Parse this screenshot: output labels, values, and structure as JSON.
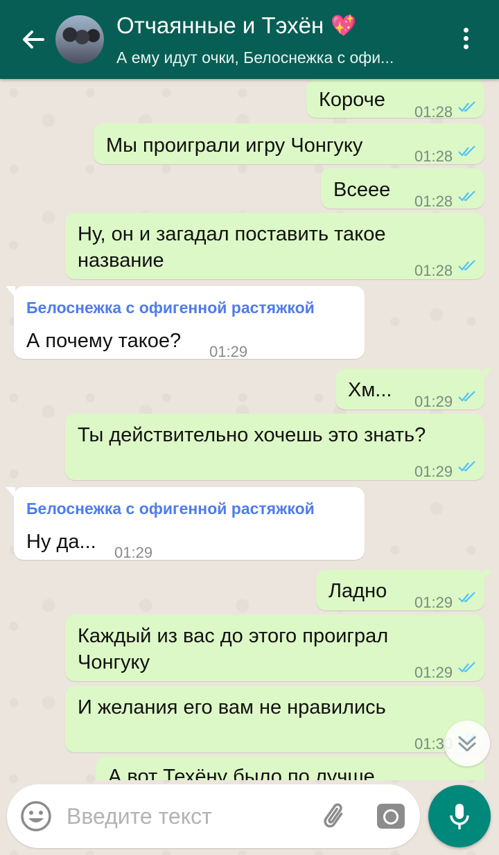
{
  "header": {
    "title": "Отчаянные и Тэхён",
    "title_emoji": "💖",
    "subtitle": "А ему идут очки, Белоснежка с офи..."
  },
  "messages": [
    {
      "type": "out",
      "text": "Короче",
      "time": "01:28",
      "status": "read"
    },
    {
      "type": "out",
      "text": "Мы проиграли игру Чонгуку",
      "time": "01:28",
      "status": "read"
    },
    {
      "type": "out",
      "text": "Всеее",
      "time": "01:28",
      "status": "read"
    },
    {
      "type": "out",
      "lines": [
        "Ну, он и загадал поставить такое",
        "название"
      ],
      "time": "01:28",
      "status": "read"
    },
    {
      "type": "in",
      "sender": "Белоснежка с офигенной растяжкой",
      "text": "А почему такое?",
      "time": "01:29"
    },
    {
      "type": "out",
      "text": "Хм...",
      "time": "01:29",
      "status": "read"
    },
    {
      "type": "out",
      "text": "Ты действительно хочешь это знать?",
      "time": "01:29",
      "status": "read"
    },
    {
      "type": "in",
      "sender": "Белоснежка с офигенной растяжкой",
      "text": "Ну да...",
      "time": "01:29"
    },
    {
      "type": "out",
      "text": "Ладно",
      "time": "01:29",
      "status": "read"
    },
    {
      "type": "out",
      "lines": [
        "Каждый из вас до этого проиграл",
        "Чонгуку"
      ],
      "time": "01:29",
      "status": "read"
    },
    {
      "type": "out",
      "text": "И желания его вам не нравились",
      "time": "01:30",
      "status": "read"
    },
    {
      "type": "out",
      "text": "А вот Техёну было по лучше",
      "status": "read"
    }
  ],
  "input": {
    "placeholder": "Введите текст"
  },
  "icons": {
    "back": "arrow-left-icon",
    "menu": "more-vertical-icon",
    "emoji": "smiley-icon",
    "attach": "paperclip-icon",
    "camera": "camera-icon",
    "mic": "microphone-icon",
    "scroll": "double-chevron-down-icon",
    "read": "double-check-icon"
  },
  "colors": {
    "header": "#075e54",
    "outgoing_bubble": "#dcf8c6",
    "incoming_bubble": "#ffffff",
    "sender_name": "#4f7cec",
    "read_ticks": "#4fc3f7",
    "mic_button": "#00897b",
    "background": "#ece5dd"
  }
}
